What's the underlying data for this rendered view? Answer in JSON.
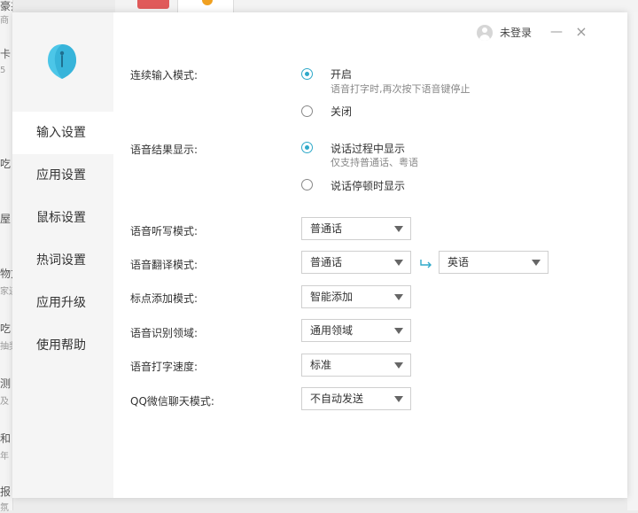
{
  "background": {
    "fragments": [
      "豪杰，米...",
      "商",
      "卡",
      "5",
      "吃",
      "屋",
      "物方",
      "家连",
      "吃",
      "抽奖",
      "测",
      "及",
      "和",
      "年",
      "报",
      "氛"
    ]
  },
  "titlebar": {
    "login_text": "未登录",
    "minimize_label": "—",
    "close_label": "×"
  },
  "sidebar": {
    "items": [
      {
        "label": "输入设置",
        "active": true
      },
      {
        "label": "应用设置",
        "active": false
      },
      {
        "label": "鼠标设置",
        "active": false
      },
      {
        "label": "热词设置",
        "active": false
      },
      {
        "label": "应用升级",
        "active": false
      },
      {
        "label": "使用帮助",
        "active": false
      }
    ]
  },
  "settings": {
    "continuous": {
      "label": "连续输入模式:",
      "options": [
        {
          "text": "开启",
          "sub": "语音打字时,再次按下语音键停止",
          "checked": true
        },
        {
          "text": "关闭",
          "sub": "",
          "checked": false
        }
      ]
    },
    "result_display": {
      "label": "语音结果显示:",
      "options": [
        {
          "text": "说话过程中显示",
          "sub": "仅支持普通话、粤语",
          "checked": true
        },
        {
          "text": "说话停顿时显示",
          "sub": "",
          "checked": false
        }
      ]
    },
    "selects": [
      {
        "label": "语音听写模式:",
        "value": "普通话"
      },
      {
        "label": "语音翻译模式:",
        "value": "普通话",
        "target_value": "英语"
      },
      {
        "label": "标点添加模式:",
        "value": "智能添加"
      },
      {
        "label": "语音识别领域:",
        "value": "通用领域"
      },
      {
        "label": "语音打字速度:",
        "value": "标准"
      },
      {
        "label": "QQ微信聊天模式:",
        "value": "不自动发送"
      }
    ]
  },
  "colors": {
    "accent": "#2fa9c9",
    "logo": "#4cc6e8"
  }
}
